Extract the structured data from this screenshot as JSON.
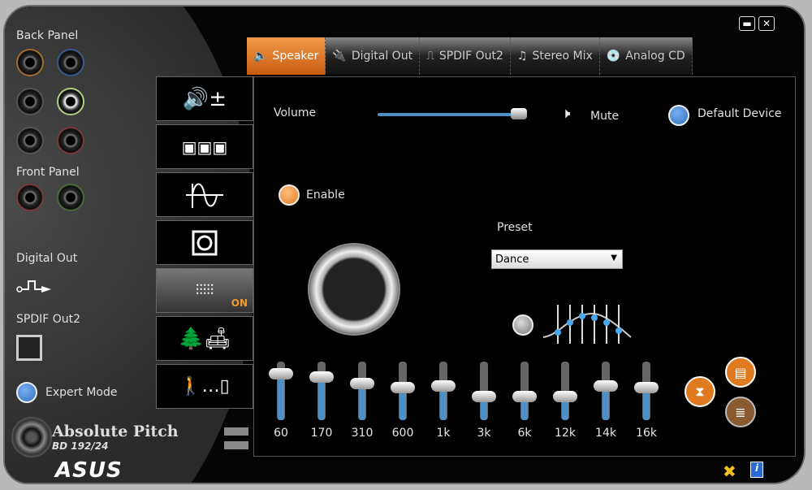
{
  "left_panel": {
    "back_panel": "Back Panel",
    "front_panel": "Front Panel",
    "digital_out": "Digital Out",
    "spdif_out2": "SPDIF Out2",
    "expert_mode": "Expert Mode",
    "brand_line1": "Absolute Pitch",
    "brand_line2": "BD 192/24",
    "logo": "ASUS"
  },
  "side_buttons": [
    {
      "icon": "speaker-volume-icon"
    },
    {
      "icon": "surround-speakers-icon"
    },
    {
      "icon": "sine-wave-icon"
    },
    {
      "icon": "subwoofer-icon"
    },
    {
      "icon": "equalizer-icon",
      "badge": "ON"
    },
    {
      "icon": "environment-icon"
    },
    {
      "icon": "room-correction-icon"
    }
  ],
  "tabs": [
    {
      "label": "Speaker",
      "active": true
    },
    {
      "label": "Digital Out"
    },
    {
      "label": "SPDIF Out2"
    },
    {
      "label": "Stereo Mix"
    },
    {
      "label": "Analog CD"
    }
  ],
  "main": {
    "volume_label": "Volume",
    "volume_level": 0.95,
    "mute_label": "Mute",
    "default_device_label": "Default Device",
    "enable_label": "Enable",
    "preset_label": "Preset",
    "preset_value": "Dance"
  },
  "equalizer": {
    "bands": [
      {
        "label": "60",
        "level": 0.79
      },
      {
        "label": "170",
        "level": 0.73
      },
      {
        "label": "310",
        "level": 0.63
      },
      {
        "label": "600",
        "level": 0.56
      },
      {
        "label": "1k",
        "level": 0.58
      },
      {
        "label": "3k",
        "level": 0.4
      },
      {
        "label": "6k",
        "level": 0.4
      },
      {
        "label": "12k",
        "level": 0.4
      },
      {
        "label": "14k",
        "level": 0.58
      },
      {
        "label": "16k",
        "level": 0.56
      }
    ]
  },
  "colors": {
    "accent": "#e07a20",
    "slider": "#4d8fc7",
    "radio_blue": "#2f6fc0"
  }
}
